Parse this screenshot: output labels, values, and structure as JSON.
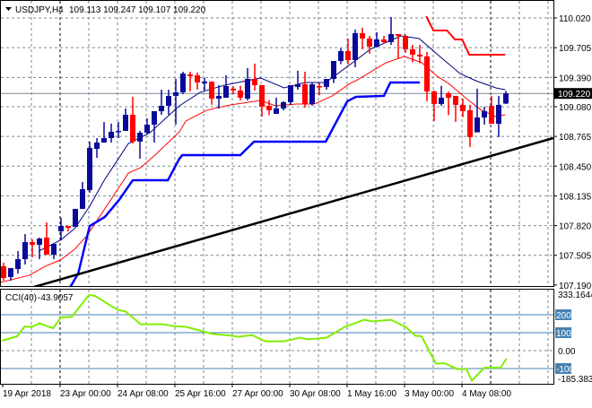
{
  "header": {
    "symbol": "USDJPY,H4",
    "ohlc": "109.113 109.247 109.107 109.220"
  },
  "colors": {
    "bull": "#0a0a9a",
    "bear": "#ff0000",
    "ma_fast": "#000080",
    "ma_slow": "#ff0000",
    "channel_low": "#0000ff",
    "channel_high": "#ff0000",
    "trend": "#000000",
    "cci": "#80ee00",
    "level": "#4682b4"
  },
  "chart_data": [
    {
      "type": "candlestick",
      "title": "USDJPY,H4",
      "price_ticks": [
        "110.020",
        "109.705",
        "109.390",
        "109.080",
        "108.765",
        "108.450",
        "108.135",
        "107.820",
        "107.505",
        "107.190"
      ],
      "ylim": [
        107.19,
        110.21
      ],
      "current_price": "109.220",
      "x_labels": [
        "19 Apr 2018",
        "23 Apr 00:00",
        "24 Apr 08:00",
        "25 Apr 16:00",
        "27 Apr 00:00",
        "30 Apr 08:00",
        "1 May 16:00",
        "3 May 00:00",
        "4 May 08:00"
      ],
      "candles_ohlc": [
        [
          107.389,
          107.427,
          107.237,
          107.265
        ],
        [
          107.275,
          107.37,
          107.237,
          107.37
        ],
        [
          107.36,
          107.55,
          107.313,
          107.465
        ],
        [
          107.465,
          107.731,
          107.408,
          107.645
        ],
        [
          107.645,
          107.674,
          107.484,
          107.617
        ],
        [
          107.617,
          107.693,
          107.465,
          107.683
        ],
        [
          107.693,
          107.854,
          107.512,
          107.512
        ],
        [
          107.512,
          107.626,
          107.464,
          107.626
        ],
        [
          107.759,
          107.902,
          107.664,
          107.816
        ],
        [
          107.816,
          107.816,
          107.759,
          107.797
        ],
        [
          107.807,
          107.997,
          107.807,
          107.997
        ],
        [
          107.997,
          108.282,
          107.997,
          108.206
        ],
        [
          108.196,
          108.709,
          108.168,
          108.643
        ],
        [
          108.633,
          108.747,
          108.538,
          108.7
        ],
        [
          108.7,
          108.918,
          108.7,
          108.747
        ],
        [
          108.747,
          108.9,
          108.7,
          108.814
        ],
        [
          108.814,
          108.918,
          108.747,
          108.823
        ],
        [
          108.823,
          109.061,
          108.823,
          108.994
        ],
        [
          108.994,
          109.184,
          108.69,
          108.71
        ],
        [
          108.71,
          108.823,
          108.529,
          108.804
        ],
        [
          108.804,
          108.956,
          108.785,
          108.89
        ],
        [
          108.89,
          108.98,
          108.7,
          109.032
        ],
        [
          109.032,
          109.26,
          108.994,
          109.089
        ],
        [
          109.089,
          109.26,
          108.994,
          109.194
        ],
        [
          109.194,
          109.374,
          108.89,
          109.232
        ],
        [
          109.232,
          109.45,
          109.213,
          109.431
        ],
        [
          109.422,
          109.45,
          109.241,
          109.403
        ],
        [
          109.412,
          109.441,
          109.26,
          109.336
        ],
        [
          109.327,
          109.384,
          109.241,
          109.346
        ],
        [
          109.346,
          109.346,
          109.099,
          109.165
        ],
        [
          109.165,
          109.308,
          109.061,
          109.194
        ],
        [
          109.175,
          109.412,
          109.175,
          109.298
        ],
        [
          109.27,
          109.3,
          109.21,
          109.251
        ],
        [
          109.251,
          109.3,
          109.146,
          109.175
        ],
        [
          109.165,
          109.488,
          109.146,
          109.374
        ],
        [
          109.374,
          109.536,
          109.251,
          109.308
        ],
        [
          109.308,
          109.308,
          108.975,
          109.08
        ],
        [
          109.089,
          109.15,
          108.99,
          109.042
        ],
        [
          109.004,
          109.175,
          109.004,
          109.061
        ],
        [
          109.061,
          109.137,
          109.04,
          109.127
        ],
        [
          109.127,
          109.308,
          109.099,
          109.308
        ],
        [
          109.289,
          109.46,
          109.26,
          109.317
        ],
        [
          109.317,
          109.45,
          109.07,
          109.108
        ],
        [
          109.108,
          109.33,
          109.09,
          109.317
        ],
        [
          109.298,
          109.33,
          109.2,
          109.289
        ],
        [
          109.289,
          109.33,
          109.26,
          109.374
        ],
        [
          109.374,
          109.4,
          109.33,
          109.564
        ],
        [
          109.564,
          109.7,
          109.53,
          109.669
        ],
        [
          109.669,
          109.802,
          109.526,
          109.574
        ],
        [
          109.574,
          109.897,
          109.498,
          109.859
        ],
        [
          109.859,
          109.916,
          109.688,
          109.802
        ],
        [
          109.802,
          109.83,
          109.64,
          109.716
        ],
        [
          109.716,
          109.868,
          109.707,
          109.792
        ],
        [
          109.792,
          109.83,
          109.75,
          109.764
        ],
        [
          109.764,
          110.03,
          109.735,
          109.849
        ],
        [
          109.849,
          109.849,
          109.593,
          109.83
        ],
        [
          109.83,
          109.849,
          109.65,
          109.688
        ],
        [
          109.688,
          109.735,
          109.55,
          109.631
        ],
        [
          109.631,
          109.735,
          109.54,
          109.612
        ],
        [
          109.612,
          109.66,
          109.137,
          109.241
        ],
        [
          109.241,
          109.251,
          108.928,
          109.108
        ],
        [
          109.108,
          109.3,
          109.09,
          109.175
        ],
        [
          109.222,
          109.24,
          108.99,
          109.175
        ],
        [
          109.194,
          109.194,
          108.918,
          109.099
        ],
        [
          109.099,
          109.165,
          108.97,
          109.032
        ],
        [
          109.042,
          109.099,
          108.652,
          108.757
        ],
        [
          108.808,
          109.27,
          108.808,
          108.965
        ],
        [
          108.965,
          109.08,
          108.89,
          109.032
        ],
        [
          109.089,
          109.194,
          108.899,
          108.899
        ],
        [
          108.899,
          109.194,
          108.757,
          109.099
        ],
        [
          109.113,
          109.247,
          109.107,
          109.22
        ]
      ],
      "series": [
        {
          "name": "ma_fast",
          "points": [
            [
              4.9,
              107.55
            ],
            [
              7.9,
              107.664
            ],
            [
              9.9,
              107.788
            ],
            [
              12,
              108.025
            ],
            [
              14.1,
              108.31
            ],
            [
              17.4,
              108.69
            ],
            [
              20.4,
              108.804
            ],
            [
              24.5,
              109.089
            ],
            [
              27.4,
              109.232
            ],
            [
              30.8,
              109.308
            ],
            [
              35.8,
              109.384
            ],
            [
              39.1,
              109.279
            ],
            [
              42,
              109.336
            ],
            [
              44.9,
              109.336
            ],
            [
              48.3,
              109.526
            ],
            [
              51.1,
              109.688
            ],
            [
              55.4,
              109.83
            ],
            [
              57.9,
              109.802
            ],
            [
              60.8,
              109.612
            ],
            [
              63.6,
              109.431
            ],
            [
              65.8,
              109.355
            ],
            [
              68.6,
              109.279
            ],
            [
              69.9,
              109.26
            ]
          ]
        },
        {
          "name": "ma_slow",
          "points": [
            [
              -0.5,
              107.218
            ],
            [
              3.6,
              107.294
            ],
            [
              5.8,
              107.389
            ],
            [
              7.9,
              107.455
            ],
            [
              9.9,
              107.569
            ],
            [
              11.6,
              107.712
            ],
            [
              14.1,
              107.997
            ],
            [
              17.4,
              108.377
            ],
            [
              19.1,
              108.434
            ],
            [
              21.1,
              108.567
            ],
            [
              24.5,
              108.814
            ],
            [
              25.4,
              108.928
            ],
            [
              28.3,
              109.042
            ],
            [
              31.6,
              109.099
            ],
            [
              35.8,
              109.146
            ],
            [
              37.9,
              109.089
            ],
            [
              40.8,
              109.108
            ],
            [
              43.3,
              109.108
            ],
            [
              45.8,
              109.194
            ],
            [
              48.3,
              109.327
            ],
            [
              49.1,
              109.355
            ],
            [
              53.3,
              109.545
            ],
            [
              55.8,
              109.612
            ],
            [
              58.3,
              109.545
            ],
            [
              60.4,
              109.403
            ],
            [
              62,
              109.327
            ],
            [
              64.5,
              109.165
            ],
            [
              66.6,
              109.042
            ],
            [
              68.6,
              108.975
            ],
            [
              69.9,
              108.994
            ]
          ]
        },
        {
          "name": "channel_low",
          "points": [
            [
              9.3,
              107.17
            ],
            [
              10.4,
              107.313
            ],
            [
              12,
              107.816
            ],
            [
              14.1,
              107.911
            ],
            [
              16.1,
              108.092
            ],
            [
              18,
              108.301
            ],
            [
              22.9,
              108.301
            ],
            [
              24.5,
              108.529
            ],
            [
              24.9,
              108.566
            ],
            [
              33,
              108.566
            ],
            [
              34.9,
              108.709
            ],
            [
              44.9,
              108.709
            ],
            [
              47.9,
              109.137
            ],
            [
              49.1,
              109.184
            ],
            [
              53,
              109.194
            ],
            [
              53.9,
              109.336
            ],
            [
              58,
              109.336
            ]
          ]
        },
        {
          "name": "channel_high",
          "points": [
            [
              58.9,
              110.039
            ],
            [
              59.9,
              109.887
            ],
            [
              61.8,
              109.887
            ],
            [
              62.9,
              109.792
            ],
            [
              63.9,
              109.792
            ],
            [
              64.9,
              109.631
            ],
            [
              69.9,
              109.631
            ]
          ]
        },
        {
          "name": "trend",
          "points": [
            [
              4.25,
              107.17
            ],
            [
              76.6,
              108.747
            ]
          ]
        }
      ]
    },
    {
      "type": "line",
      "title": "CCI(40)",
      "current_value": "-43.9057",
      "scale_max": "333.1644",
      "scale_min": "-185.3837",
      "level_labels": [
        "200",
        "100",
        "0.00",
        "-100"
      ],
      "levels": [
        200,
        100,
        -100
      ],
      "values": [
        [
          -0.25,
          55
        ],
        [
          1.9,
          80
        ],
        [
          2.9,
          133
        ],
        [
          4,
          133
        ],
        [
          5,
          152
        ],
        [
          6.9,
          125
        ],
        [
          8,
          185
        ],
        [
          9.5,
          188
        ],
        [
          11.9,
          310
        ],
        [
          12.75,
          305
        ],
        [
          15.9,
          227
        ],
        [
          17,
          218
        ],
        [
          19.1,
          147
        ],
        [
          22.25,
          147
        ],
        [
          23.9,
          135
        ],
        [
          25.4,
          133
        ],
        [
          29.1,
          93
        ],
        [
          31.75,
          83
        ],
        [
          32.75,
          77
        ],
        [
          34.6,
          87
        ],
        [
          36.5,
          52
        ],
        [
          39.1,
          52
        ],
        [
          41.25,
          72
        ],
        [
          42.4,
          63
        ],
        [
          45,
          72
        ],
        [
          47.6,
          133
        ],
        [
          50.25,
          172
        ],
        [
          51.4,
          163
        ],
        [
          54,
          172
        ],
        [
          56.1,
          130
        ],
        [
          57.4,
          83
        ],
        [
          58.25,
          80
        ],
        [
          60.25,
          -73
        ],
        [
          61.4,
          -70
        ],
        [
          63.25,
          -103
        ],
        [
          64.5,
          -103
        ],
        [
          65.25,
          -167
        ],
        [
          67,
          -95
        ],
        [
          69.25,
          -95
        ],
        [
          70.1,
          -44
        ]
      ]
    }
  ]
}
